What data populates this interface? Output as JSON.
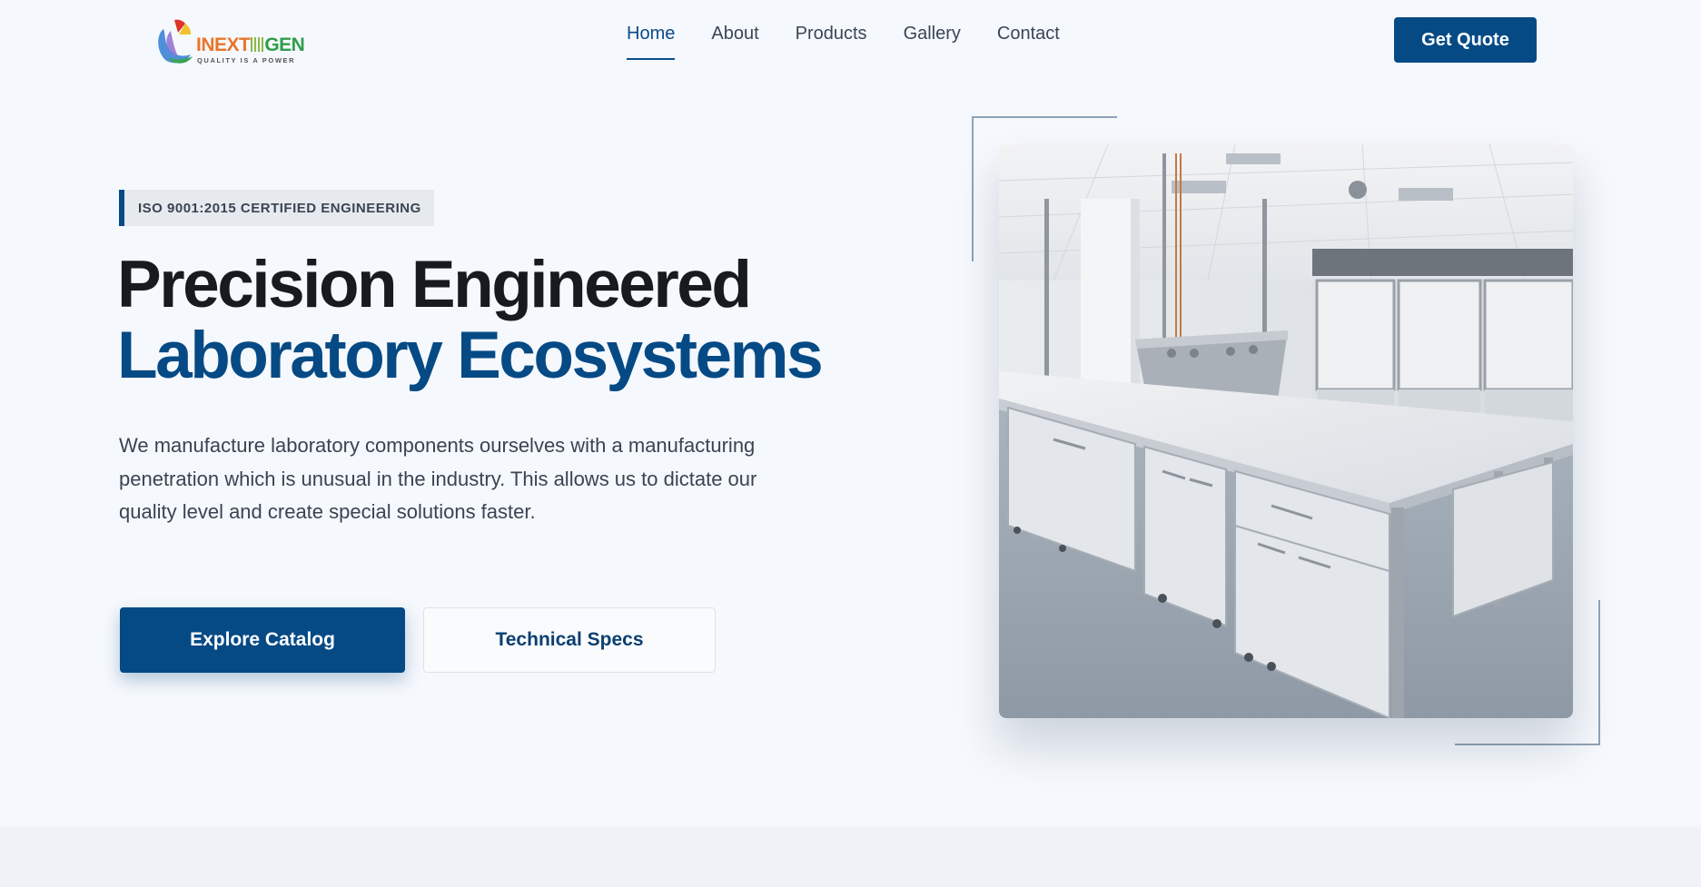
{
  "brand": {
    "name_part1": "INEXT",
    "name_part2": "GEN",
    "tagline": "QUALITY IS A POWER"
  },
  "nav": {
    "items": [
      {
        "label": "Home",
        "active": true
      },
      {
        "label": "About",
        "active": false
      },
      {
        "label": "Products",
        "active": false
      },
      {
        "label": "Gallery",
        "active": false
      },
      {
        "label": "Contact",
        "active": false
      }
    ],
    "cta_label": "Get Quote"
  },
  "hero": {
    "badge": "ISO 9001:2015 CERTIFIED ENGINEERING",
    "headline_line1": "Precision Engineered",
    "headline_line2": "Laboratory Ecosystems",
    "description": "We manufacture laboratory components ourselves with a manufacturing penetration which is unusual in the industry. This allows us to dictate our quality level and create special solutions faster.",
    "primary_button": "Explore Catalog",
    "secondary_button": "Technical Specs"
  },
  "colors": {
    "brand_blue": "#054a85",
    "background": "#f5f8fc",
    "text_dark": "#171a1e",
    "text_body": "#3a4452"
  }
}
